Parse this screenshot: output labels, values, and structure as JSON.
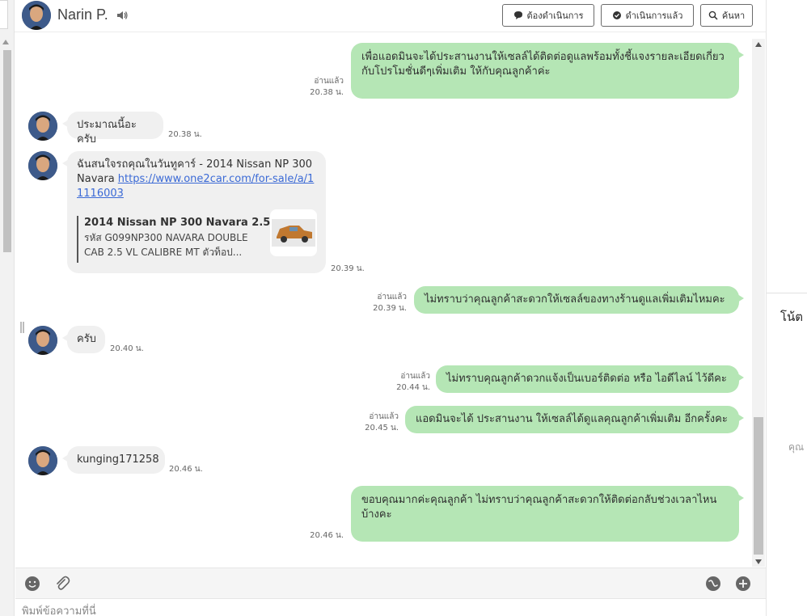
{
  "header": {
    "contact_name": "Narin P.",
    "buttons": {
      "pending": "ต้องดำเนินการ",
      "done": "ดำเนินการแล้ว",
      "search": "ค้นหา"
    }
  },
  "messages": [
    {
      "dir": "out",
      "text": "เพื่อแอดมินจะได้ประสานงานให้เซลล์ได้ติดต่อดูแลพร้อมทั้งชี้แจงรายละเอียดเกี่ยวกับโปรโมชั่นดีๆเพิ่มเติม ให้กับคุณลูกค้าค่ะ",
      "status": "อ่านแล้ว",
      "time": "20.38 น."
    },
    {
      "dir": "in",
      "text": "ประมาณนี้อะครับ",
      "time": "20.38 น."
    },
    {
      "dir": "in",
      "text_prefix": "ฉันสนใจรถคุณในวันทูคาร์ - 2014 Nissan NP 300 Navara ",
      "link": "https://www.one2car.com/for-sale/a/11116003",
      "preview_title": "2014 Nissan NP 300 Navara 2.5 ...",
      "preview_desc": "รหัส G099NP300 NAVARA DOUBLE CAB 2.5 VL CALIBRE MT ตัวท็อป...",
      "time": "20.39 น."
    },
    {
      "dir": "out",
      "text": "ไม่ทราบว่าคุณลูกค้าสะดวกให้เซลล์ของทางร้านดูแลเพิ่มเติมไหมคะ",
      "status": "อ่านแล้ว",
      "time": "20.39 น."
    },
    {
      "dir": "in",
      "text": "ครับ",
      "time": "20.40 น."
    },
    {
      "dir": "out",
      "text": "ไม่ทราบคุณลูกค้าดวกแจ้งเป็นเบอร์ติดต่อ หรือ ไอดีไลน์ ไว้ดีคะ",
      "status": "อ่านแล้ว",
      "time": "20.44 น."
    },
    {
      "dir": "out",
      "text": "แอดมินจะได้ ประสานงาน ให้เซลล์ได้ดูแลคุณลูกค้าเพิ่มเติม อีกครั้งคะ",
      "status": "อ่านแล้ว",
      "time": "20.45 น."
    },
    {
      "dir": "in",
      "text": "kunging171258",
      "time": "20.46 น."
    },
    {
      "dir": "out",
      "text": "ขอบคุณมากค่ะคุณลูกค้า ไม่ทราบว่าคุณลูกค้าสะดวกให้ติดต่อกลับช่วงเวลาไหนบ้างคะ",
      "time": "20.46 น."
    }
  ],
  "composer": {
    "placeholder": "พิมพ์ข้อความที่นี่"
  },
  "right_panel": {
    "notes_title": "โน้ต",
    "hint": "คุณ"
  },
  "colors": {
    "outgoing_bubble": "#b5e6b5",
    "incoming_bubble": "#f0f0f0",
    "link": "#3b6ad6"
  },
  "icons": [
    "speaker-icon",
    "speech-bubble-icon",
    "chat-check-icon",
    "search-icon",
    "emoji-icon",
    "paperclip-icon",
    "sticker-icon",
    "add-circle-icon"
  ]
}
